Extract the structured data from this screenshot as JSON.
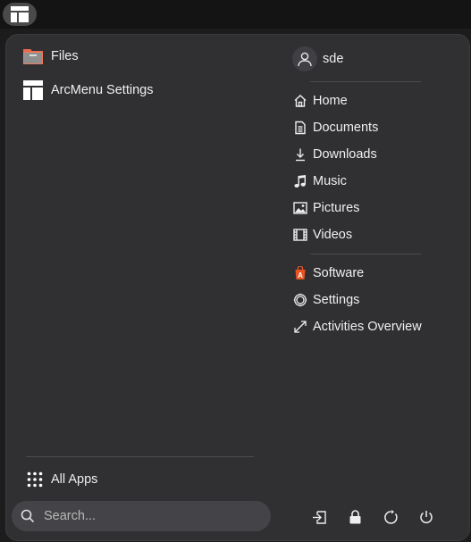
{
  "apps": [
    {
      "label": "Files",
      "icon": "folder-icon"
    },
    {
      "label": "ArcMenu Settings",
      "icon": "arcmenu-layout-icon"
    }
  ],
  "all_apps_label": "All Apps",
  "search": {
    "placeholder": "Search..."
  },
  "user": {
    "name": "sde"
  },
  "places": [
    {
      "label": "Home",
      "icon": "home-icon"
    },
    {
      "label": "Documents",
      "icon": "document-icon"
    },
    {
      "label": "Downloads",
      "icon": "download-icon"
    },
    {
      "label": "Music",
      "icon": "music-icon"
    },
    {
      "label": "Pictures",
      "icon": "picture-icon"
    },
    {
      "label": "Videos",
      "icon": "video-icon"
    }
  ],
  "system": [
    {
      "label": "Software",
      "icon": "software-icon"
    },
    {
      "label": "Settings",
      "icon": "settings-gear-icon"
    },
    {
      "label": "Activities Overview",
      "icon": "expand-arrows-icon"
    }
  ],
  "power_buttons": [
    "logout-icon",
    "lock-icon",
    "restart-icon",
    "power-icon"
  ],
  "colors": {
    "folder": "#e8694b",
    "software": "#e95420",
    "panel": "#303033",
    "search": "#444448"
  }
}
